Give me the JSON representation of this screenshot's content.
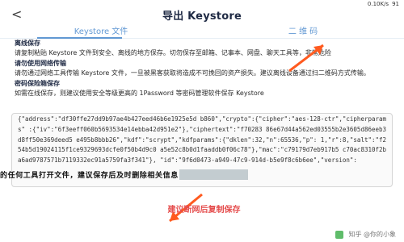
{
  "status_bar": {
    "time": "<",
    "signal": "0.10K/s",
    "battery": "91"
  },
  "header": {
    "title": "导出 Keystore"
  },
  "tabs": [
    {
      "label": "Keystore 文件"
    },
    {
      "label": "二 维 码"
    }
  ],
  "content": {
    "intro_title": "离线保存",
    "intro_text": "请复制粘贴 Keystore 文件到安全、离线的地方保存。切勿保存至邮箱、记事本、网盘、聊天工具等，非常危险",
    "section1_title": "请勿使用网络传输",
    "section1_text": "请勿通过网络工具传输 Keystore 文件，一旦被黑客获取将造成不可挽回的资产损失。建议离线设备通过扫二维码方式传输。",
    "section2_title": "密码保险箱保存",
    "section2_text": "如需在线保存，则建议使用安全等级更高的 1Password 等密码管理软件保存 Keystore"
  },
  "keystore": {
    "text": "{\"address\":\"df30ffe27dd9b97ae4b427eed46b6e1925e5d b860\",\"crypto\":{\"cipher\":\"aes-128-ctr\",\"cipherparams\" :{\"iv\":\"6f3eeff060b5693534e14ebba42d951e2\"},\"ciphertext\":\"f70283 86e67d44a562ed03555b2e3605d86eeb3d8ff50e369deed5 e495b8bbb26\",\"kdf\":\"scrypt\",\"kdfparams\":{\"dklen\":32,\"n\":65536,\"p\": 1,\"r\":8,\"salt\":\"f254b5d19024115f1ce9329693dcfe0f50b4d9c0 a5e52c8b0d1faaddb0f06c78\"},\"mac\":\"c79179d7eb917b5 c70ac8310f2ba6ad9787571b7119332ec91a5759fa3f341\"}, \"id\":\"9f6d0473-a949-47c9-914d-b5e9f8c6b6ee\",\"version\":"
  },
  "overlay": {
    "text": "的任何工具打开文件，建议保存后及时删除相关信息"
  },
  "actions": {
    "copy_label": "建议断网后复制保存"
  },
  "watermark": {
    "text": "知乎 @你的小象"
  }
}
